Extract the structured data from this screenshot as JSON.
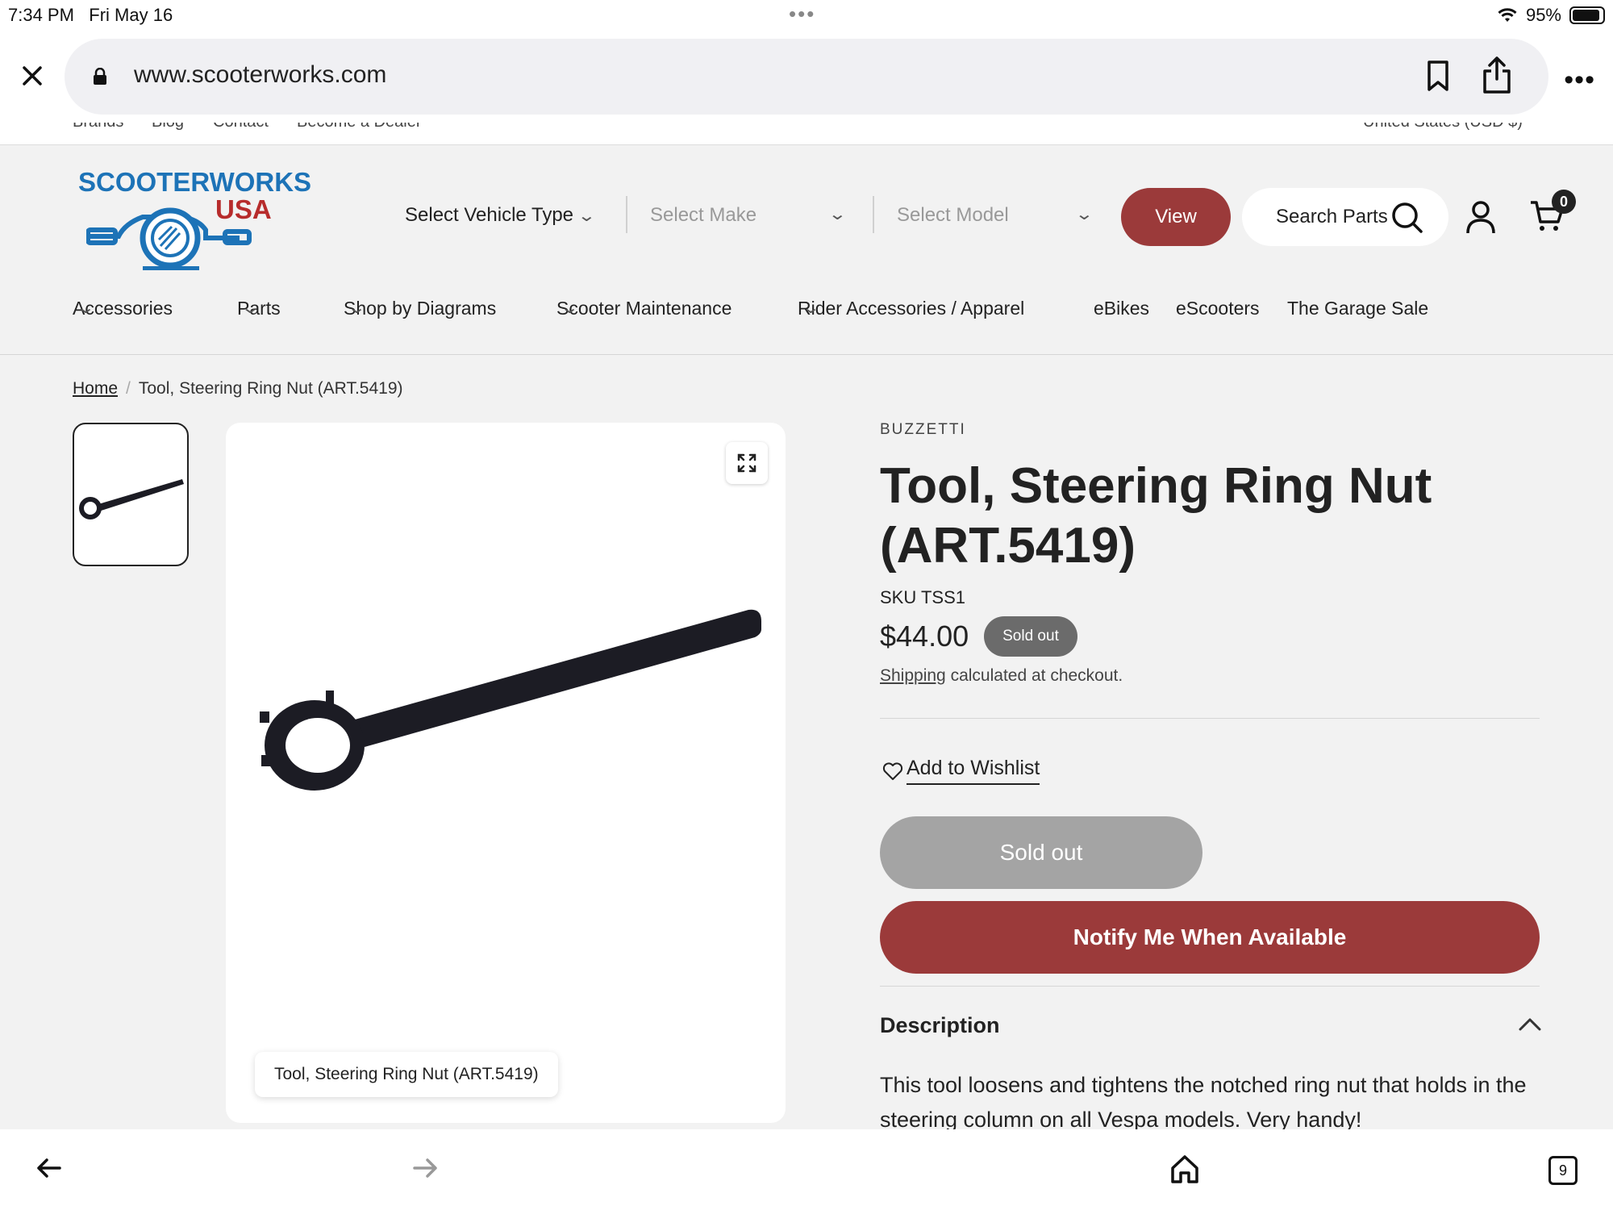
{
  "status": {
    "time": "7:34 PM",
    "date": "Fri May 16",
    "dots": "•••",
    "battery": "95%"
  },
  "browser": {
    "url": "www.scooterworks.com"
  },
  "topnav_cut": [
    "Brands",
    "Blog",
    "Contact",
    "Become a Dealer",
    "United States (USD $)"
  ],
  "logo": {
    "line1": "SCOOTERWORKS",
    "line2": "USA"
  },
  "vehicle": {
    "type_label": "Select Vehicle Type",
    "make_placeholder": "Select Make",
    "model_placeholder": "Select Model",
    "view_label": "View"
  },
  "search": {
    "label": "Search Parts"
  },
  "cart": {
    "count": "0"
  },
  "nav": [
    "Accessories",
    "Parts",
    "Shop by Diagrams",
    "Scooter Maintenance",
    "Rider Accessories / Apparel",
    "eBikes",
    "eScooters",
    "The Garage Sale"
  ],
  "breadcrumb": {
    "home": "Home",
    "sep": "/",
    "current": "Tool, Steering Ring Nut (ART.5419)"
  },
  "product": {
    "vendor": "BUZZETTI",
    "title": "Tool, Steering Ring Nut (ART.5419)",
    "sku": "SKU TSS1",
    "price": "$44.00",
    "badge": "Sold out",
    "shipping_link": "Shipping",
    "shipping_text": " calculated at checkout.",
    "wishlist": "Add to Wishlist",
    "soldout_button": "Sold out",
    "notify_button": "Notify Me When Available",
    "image_caption": "Tool, Steering Ring Nut (ART.5419)"
  },
  "description": {
    "heading": "Description",
    "text": "This tool loosens and tightens the notched ring nut that holds in the steering column on all Vespa models. Very handy!"
  },
  "tabs": {
    "count": "9"
  },
  "colors": {
    "brand_blue": "#1d73b7",
    "brand_red": "#b72c2c",
    "accent": "#9b3a3a",
    "disabled": "#a4a4a4",
    "badge": "#6b6b6b"
  }
}
